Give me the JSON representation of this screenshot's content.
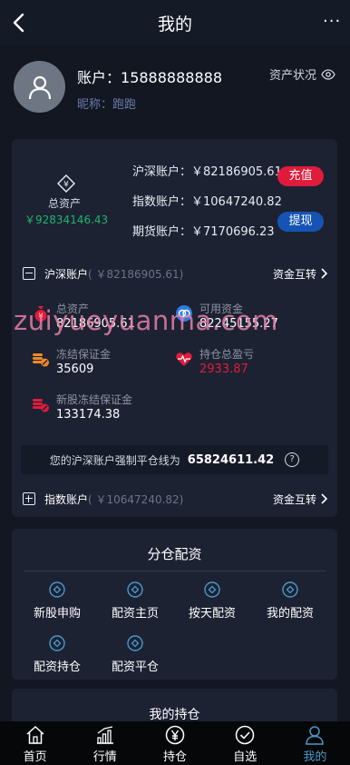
{
  "header": {
    "title": "我的",
    "more": "···"
  },
  "profile": {
    "account_label": "账户：",
    "account_value": "15888888888",
    "nickname_label": "昵称：",
    "nickname_value": "跑跑",
    "asset_status": "资产状况"
  },
  "summary": {
    "total_label": "总资产",
    "total_value": "￥92834146.43",
    "sub_accounts": [
      {
        "label": "沪深账户：￥82186905.61"
      },
      {
        "label": "指数账户：￥10647240.82"
      },
      {
        "label": "期货账户：￥7170696.23"
      }
    ],
    "recharge": "充值",
    "withdraw": "提现"
  },
  "hs_account": {
    "name": "沪深账户",
    "amount": "( ￥82186905.61)",
    "transfer": "资金互转",
    "metrics": [
      {
        "label": "总资产",
        "value": "82186905.61"
      },
      {
        "label": "可用资金",
        "value": "82245155.27"
      },
      {
        "label": "冻结保证金",
        "value": "35609"
      },
      {
        "label": "持仓总盈亏",
        "value": "2933.87"
      },
      {
        "label": "新股冻结保证金",
        "value": "133174.38"
      }
    ],
    "forced_text": "您的沪深账户强制平仓线为",
    "forced_value": "65824611.42",
    "forced_help": "?"
  },
  "index_account": {
    "name": "指数账户",
    "amount": "( ￥10647240.82)",
    "transfer": "资金互转"
  },
  "allocation": {
    "title": "分仓配资",
    "items": [
      {
        "label": "新股申购"
      },
      {
        "label": "配资主页"
      },
      {
        "label": "按天配资"
      },
      {
        "label": "我的配资"
      },
      {
        "label": "配资持仓"
      },
      {
        "label": "配资平仓"
      }
    ]
  },
  "holdings": {
    "title": "我的持仓"
  },
  "tabbar": {
    "items": [
      {
        "label": "首页"
      },
      {
        "label": "行情"
      },
      {
        "label": "持仓"
      },
      {
        "label": "自选"
      },
      {
        "label": "我的"
      }
    ],
    "active_index": 4
  },
  "watermark": "zuiyueyuanma.com",
  "colors": {
    "green": "#23b26c",
    "red": "#e01b3c",
    "blue": "#1554b4",
    "accent": "#4b98c9"
  }
}
